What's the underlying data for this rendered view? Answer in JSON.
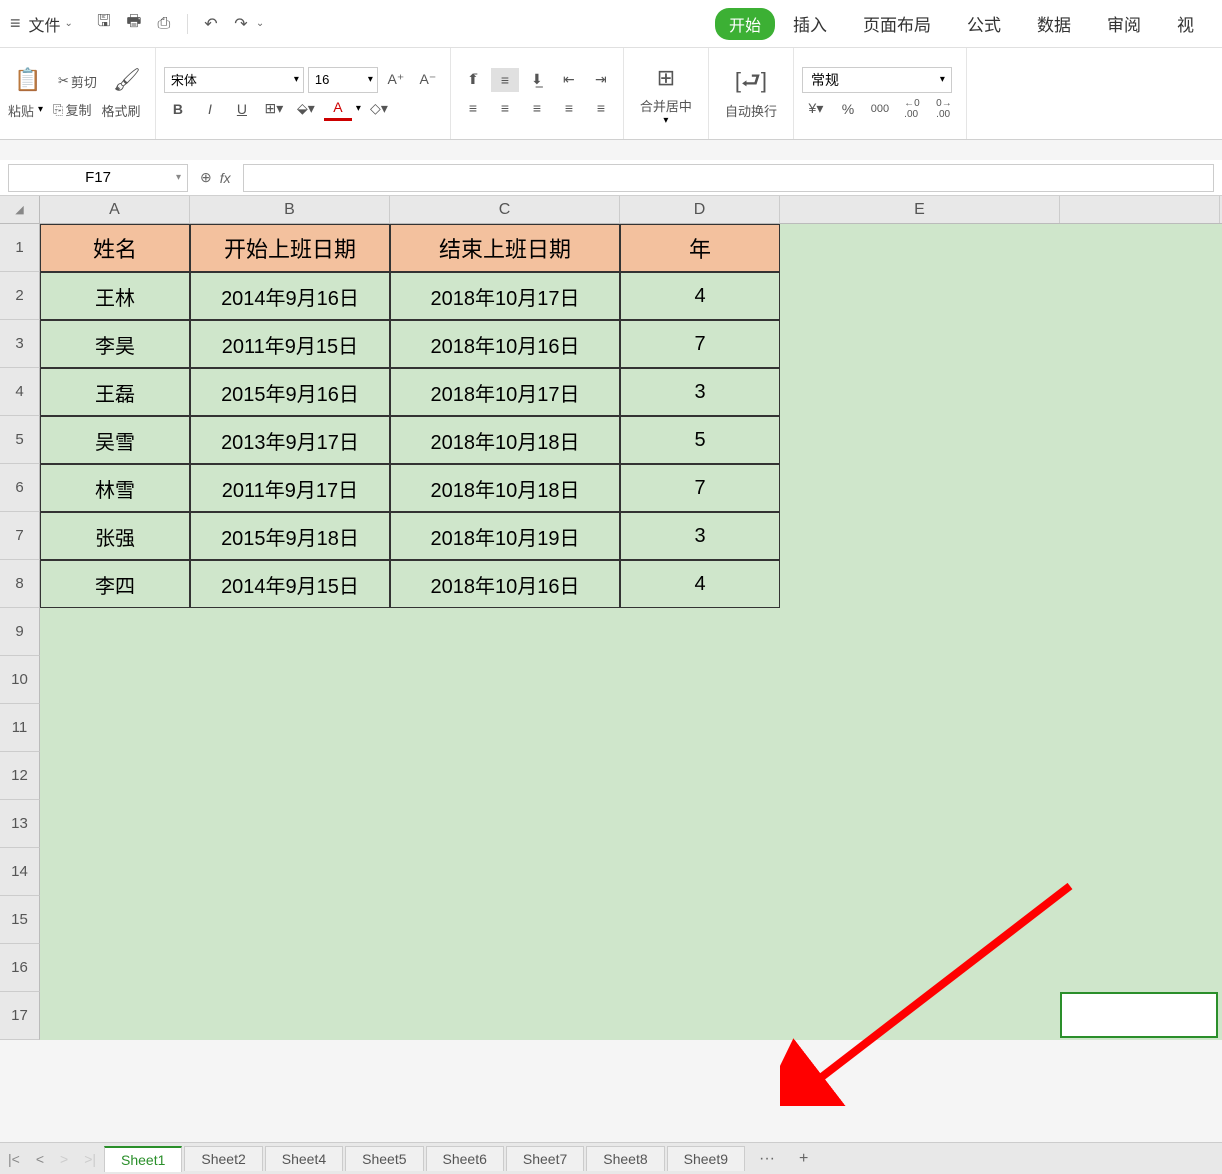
{
  "menu": {
    "file": "文件",
    "tabs": [
      "开始",
      "插入",
      "页面布局",
      "公式",
      "数据",
      "审阅",
      "视"
    ]
  },
  "ribbon": {
    "paste": "粘贴",
    "cut": "剪切",
    "copy": "复制",
    "format_painter": "格式刷",
    "font_name": "宋体",
    "font_size": "16",
    "merge_center": "合并居中",
    "wrap_text": "自动换行",
    "number_format": "常规"
  },
  "namebox": "F17",
  "columns": [
    "A",
    "B",
    "C",
    "D",
    "E"
  ],
  "table": {
    "headers": [
      "姓名",
      "开始上班日期",
      "结束上班日期",
      "年"
    ],
    "rows": [
      [
        "王林",
        "2014年9月16日",
        "2018年10月17日",
        "4"
      ],
      [
        "李昊",
        "2011年9月15日",
        "2018年10月16日",
        "7"
      ],
      [
        "王磊",
        "2015年9月16日",
        "2018年10月17日",
        "3"
      ],
      [
        "吴雪",
        "2013年9月17日",
        "2018年10月18日",
        "5"
      ],
      [
        "林雪",
        "2011年9月17日",
        "2018年10月18日",
        "7"
      ],
      [
        "张强",
        "2015年9月18日",
        "2018年10月19日",
        "3"
      ],
      [
        "李四",
        "2014年9月15日",
        "2018年10月16日",
        "4"
      ]
    ]
  },
  "sheets": [
    "Sheet1",
    "Sheet2",
    "Sheet4",
    "Sheet5",
    "Sheet6",
    "Sheet7",
    "Sheet8",
    "Sheet9"
  ]
}
